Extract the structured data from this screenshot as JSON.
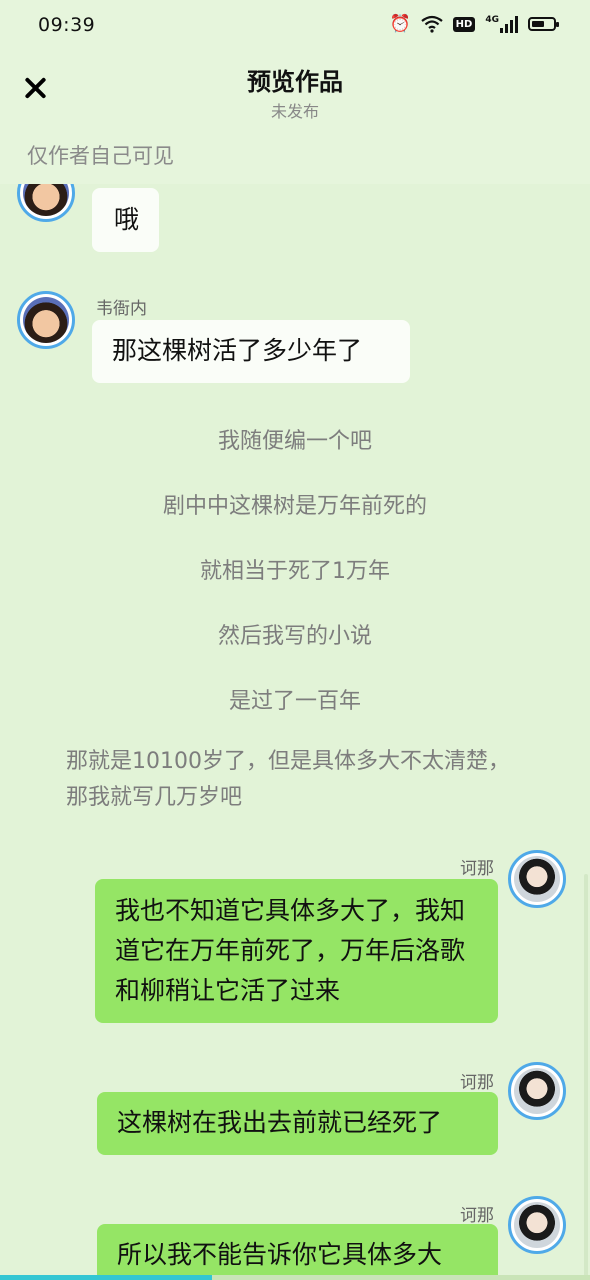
{
  "status_bar": {
    "time": "09:39",
    "network_badge": "HD",
    "network_type": "4G",
    "alarm_icon": "alarm-clock-icon",
    "wifi_icon": "wifi-icon",
    "battery_level": 0.62
  },
  "header": {
    "close_icon": "close-icon",
    "title": "预览作品",
    "subtitle": "未发布"
  },
  "visibility_note": "仅作者自己可见",
  "messages": [
    {
      "type": "left",
      "sender": "",
      "text": "哦"
    },
    {
      "type": "left",
      "sender": "韦衙内",
      "text": "那这棵树活了多少年了"
    },
    {
      "type": "narration",
      "text": "我随便编一个吧"
    },
    {
      "type": "narration",
      "text": "剧中中这棵树是万年前死的"
    },
    {
      "type": "narration",
      "text": "就相当于死了1万年"
    },
    {
      "type": "narration",
      "text": "然后我写的小说"
    },
    {
      "type": "narration",
      "text": "是过了一百年"
    },
    {
      "type": "narration",
      "text": "那就是10100岁了，但是具体多大不太清楚，那我就写几万岁吧"
    },
    {
      "type": "right",
      "sender": "诃那",
      "text": "我也不知道它具体多大了，我知道它在万年前死了，万年后洛歌和柳稍让它活了过来"
    },
    {
      "type": "right",
      "sender": "诃那",
      "text": "这棵树在我出去前就已经死了"
    },
    {
      "type": "right",
      "sender": "诃那",
      "text": "所以我不能告诉你它具体多大"
    }
  ],
  "reading_progress": 0.36,
  "colors": {
    "background": "#e2f3d7",
    "right_bubble": "#95e565",
    "left_bubble": "#fafdf8",
    "avatar_ring": "#4fa9e8",
    "progress": "#33c6d3"
  }
}
